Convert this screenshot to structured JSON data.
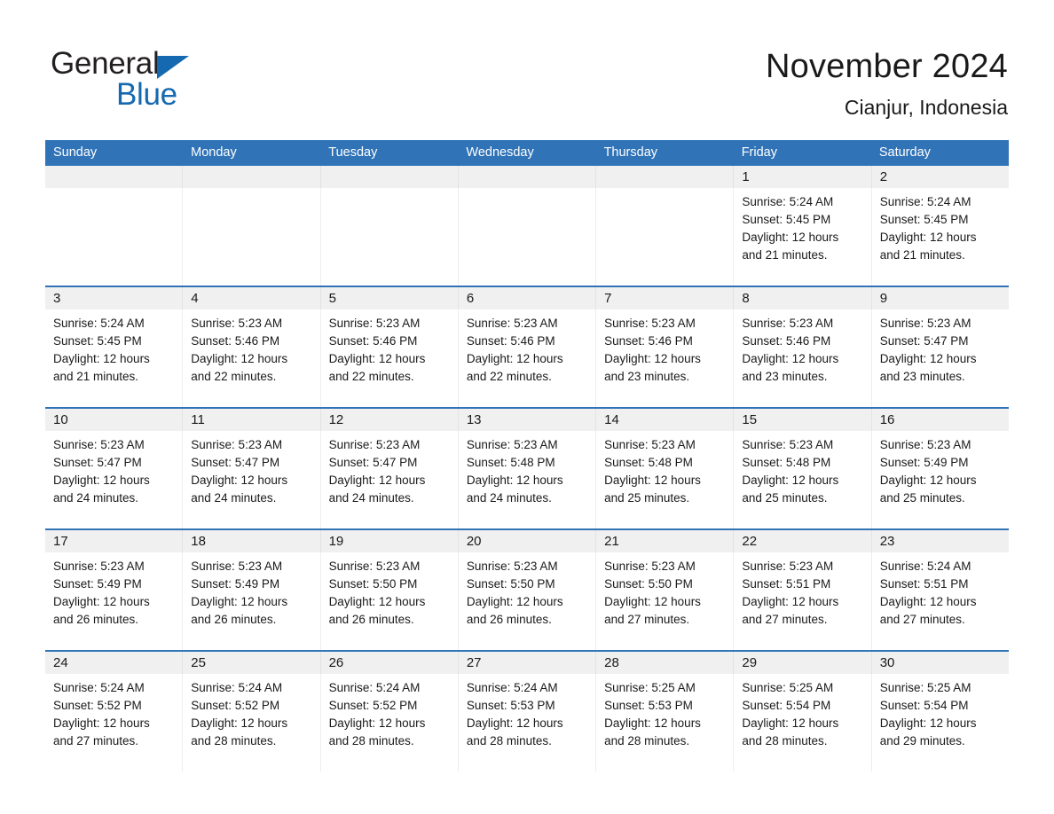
{
  "brand": {
    "name_part1": "General",
    "name_part2": "Blue",
    "triangle_icon": "blue-triangle-icon",
    "accent_color": "#1569b0"
  },
  "header": {
    "title": "November 2024",
    "subtitle": "Cianjur, Indonesia"
  },
  "theme": {
    "header_blue": "#3073b7",
    "row_divider_blue": "#3073b7",
    "date_band_gray": "#f0f0f0",
    "text_color": "#1a1a1a"
  },
  "weekdays": [
    "Sunday",
    "Monday",
    "Tuesday",
    "Wednesday",
    "Thursday",
    "Friday",
    "Saturday"
  ],
  "weeks": [
    [
      {
        "date": "",
        "lines": []
      },
      {
        "date": "",
        "lines": []
      },
      {
        "date": "",
        "lines": []
      },
      {
        "date": "",
        "lines": []
      },
      {
        "date": "",
        "lines": []
      },
      {
        "date": "1",
        "lines": [
          "Sunrise: 5:24 AM",
          "Sunset: 5:45 PM",
          "Daylight: 12 hours",
          "and 21 minutes."
        ]
      },
      {
        "date": "2",
        "lines": [
          "Sunrise: 5:24 AM",
          "Sunset: 5:45 PM",
          "Daylight: 12 hours",
          "and 21 minutes."
        ]
      }
    ],
    [
      {
        "date": "3",
        "lines": [
          "Sunrise: 5:24 AM",
          "Sunset: 5:45 PM",
          "Daylight: 12 hours",
          "and 21 minutes."
        ]
      },
      {
        "date": "4",
        "lines": [
          "Sunrise: 5:23 AM",
          "Sunset: 5:46 PM",
          "Daylight: 12 hours",
          "and 22 minutes."
        ]
      },
      {
        "date": "5",
        "lines": [
          "Sunrise: 5:23 AM",
          "Sunset: 5:46 PM",
          "Daylight: 12 hours",
          "and 22 minutes."
        ]
      },
      {
        "date": "6",
        "lines": [
          "Sunrise: 5:23 AM",
          "Sunset: 5:46 PM",
          "Daylight: 12 hours",
          "and 22 minutes."
        ]
      },
      {
        "date": "7",
        "lines": [
          "Sunrise: 5:23 AM",
          "Sunset: 5:46 PM",
          "Daylight: 12 hours",
          "and 23 minutes."
        ]
      },
      {
        "date": "8",
        "lines": [
          "Sunrise: 5:23 AM",
          "Sunset: 5:46 PM",
          "Daylight: 12 hours",
          "and 23 minutes."
        ]
      },
      {
        "date": "9",
        "lines": [
          "Sunrise: 5:23 AM",
          "Sunset: 5:47 PM",
          "Daylight: 12 hours",
          "and 23 minutes."
        ]
      }
    ],
    [
      {
        "date": "10",
        "lines": [
          "Sunrise: 5:23 AM",
          "Sunset: 5:47 PM",
          "Daylight: 12 hours",
          "and 24 minutes."
        ]
      },
      {
        "date": "11",
        "lines": [
          "Sunrise: 5:23 AM",
          "Sunset: 5:47 PM",
          "Daylight: 12 hours",
          "and 24 minutes."
        ]
      },
      {
        "date": "12",
        "lines": [
          "Sunrise: 5:23 AM",
          "Sunset: 5:47 PM",
          "Daylight: 12 hours",
          "and 24 minutes."
        ]
      },
      {
        "date": "13",
        "lines": [
          "Sunrise: 5:23 AM",
          "Sunset: 5:48 PM",
          "Daylight: 12 hours",
          "and 24 minutes."
        ]
      },
      {
        "date": "14",
        "lines": [
          "Sunrise: 5:23 AM",
          "Sunset: 5:48 PM",
          "Daylight: 12 hours",
          "and 25 minutes."
        ]
      },
      {
        "date": "15",
        "lines": [
          "Sunrise: 5:23 AM",
          "Sunset: 5:48 PM",
          "Daylight: 12 hours",
          "and 25 minutes."
        ]
      },
      {
        "date": "16",
        "lines": [
          "Sunrise: 5:23 AM",
          "Sunset: 5:49 PM",
          "Daylight: 12 hours",
          "and 25 minutes."
        ]
      }
    ],
    [
      {
        "date": "17",
        "lines": [
          "Sunrise: 5:23 AM",
          "Sunset: 5:49 PM",
          "Daylight: 12 hours",
          "and 26 minutes."
        ]
      },
      {
        "date": "18",
        "lines": [
          "Sunrise: 5:23 AM",
          "Sunset: 5:49 PM",
          "Daylight: 12 hours",
          "and 26 minutes."
        ]
      },
      {
        "date": "19",
        "lines": [
          "Sunrise: 5:23 AM",
          "Sunset: 5:50 PM",
          "Daylight: 12 hours",
          "and 26 minutes."
        ]
      },
      {
        "date": "20",
        "lines": [
          "Sunrise: 5:23 AM",
          "Sunset: 5:50 PM",
          "Daylight: 12 hours",
          "and 26 minutes."
        ]
      },
      {
        "date": "21",
        "lines": [
          "Sunrise: 5:23 AM",
          "Sunset: 5:50 PM",
          "Daylight: 12 hours",
          "and 27 minutes."
        ]
      },
      {
        "date": "22",
        "lines": [
          "Sunrise: 5:23 AM",
          "Sunset: 5:51 PM",
          "Daylight: 12 hours",
          "and 27 minutes."
        ]
      },
      {
        "date": "23",
        "lines": [
          "Sunrise: 5:24 AM",
          "Sunset: 5:51 PM",
          "Daylight: 12 hours",
          "and 27 minutes."
        ]
      }
    ],
    [
      {
        "date": "24",
        "lines": [
          "Sunrise: 5:24 AM",
          "Sunset: 5:52 PM",
          "Daylight: 12 hours",
          "and 27 minutes."
        ]
      },
      {
        "date": "25",
        "lines": [
          "Sunrise: 5:24 AM",
          "Sunset: 5:52 PM",
          "Daylight: 12 hours",
          "and 28 minutes."
        ]
      },
      {
        "date": "26",
        "lines": [
          "Sunrise: 5:24 AM",
          "Sunset: 5:52 PM",
          "Daylight: 12 hours",
          "and 28 minutes."
        ]
      },
      {
        "date": "27",
        "lines": [
          "Sunrise: 5:24 AM",
          "Sunset: 5:53 PM",
          "Daylight: 12 hours",
          "and 28 minutes."
        ]
      },
      {
        "date": "28",
        "lines": [
          "Sunrise: 5:25 AM",
          "Sunset: 5:53 PM",
          "Daylight: 12 hours",
          "and 28 minutes."
        ]
      },
      {
        "date": "29",
        "lines": [
          "Sunrise: 5:25 AM",
          "Sunset: 5:54 PM",
          "Daylight: 12 hours",
          "and 28 minutes."
        ]
      },
      {
        "date": "30",
        "lines": [
          "Sunrise: 5:25 AM",
          "Sunset: 5:54 PM",
          "Daylight: 12 hours",
          "and 29 minutes."
        ]
      }
    ]
  ]
}
